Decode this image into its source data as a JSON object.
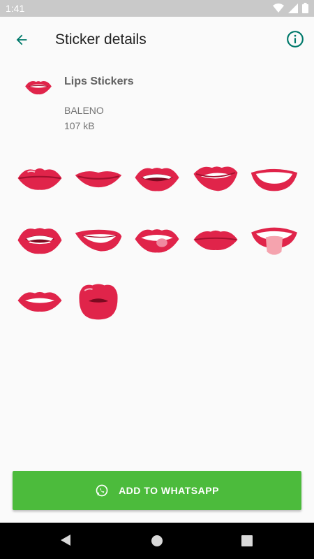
{
  "status": {
    "time": "1:41"
  },
  "app_bar": {
    "title": "Sticker details"
  },
  "pack": {
    "name": "Lips Stickers",
    "publisher": "BALENO",
    "size": "107 kB"
  },
  "stickers": [
    {
      "variant": "closed"
    },
    {
      "variant": "thin-smile"
    },
    {
      "variant": "teeth"
    },
    {
      "variant": "bite"
    },
    {
      "variant": "wide-smile"
    },
    {
      "variant": "teeth-open"
    },
    {
      "variant": "side-smile"
    },
    {
      "variant": "tongue-lick"
    },
    {
      "variant": "closed-plain"
    },
    {
      "variant": "tongue-out"
    },
    {
      "variant": "teeth-small"
    },
    {
      "variant": "kiss"
    }
  ],
  "add_button": {
    "label": "ADD TO WHATSAPP"
  },
  "colors": {
    "accent": "#00796b",
    "button_green": "#4cbb3c",
    "lip_red": "#e0244a",
    "lip_dark": "#a3102e"
  }
}
